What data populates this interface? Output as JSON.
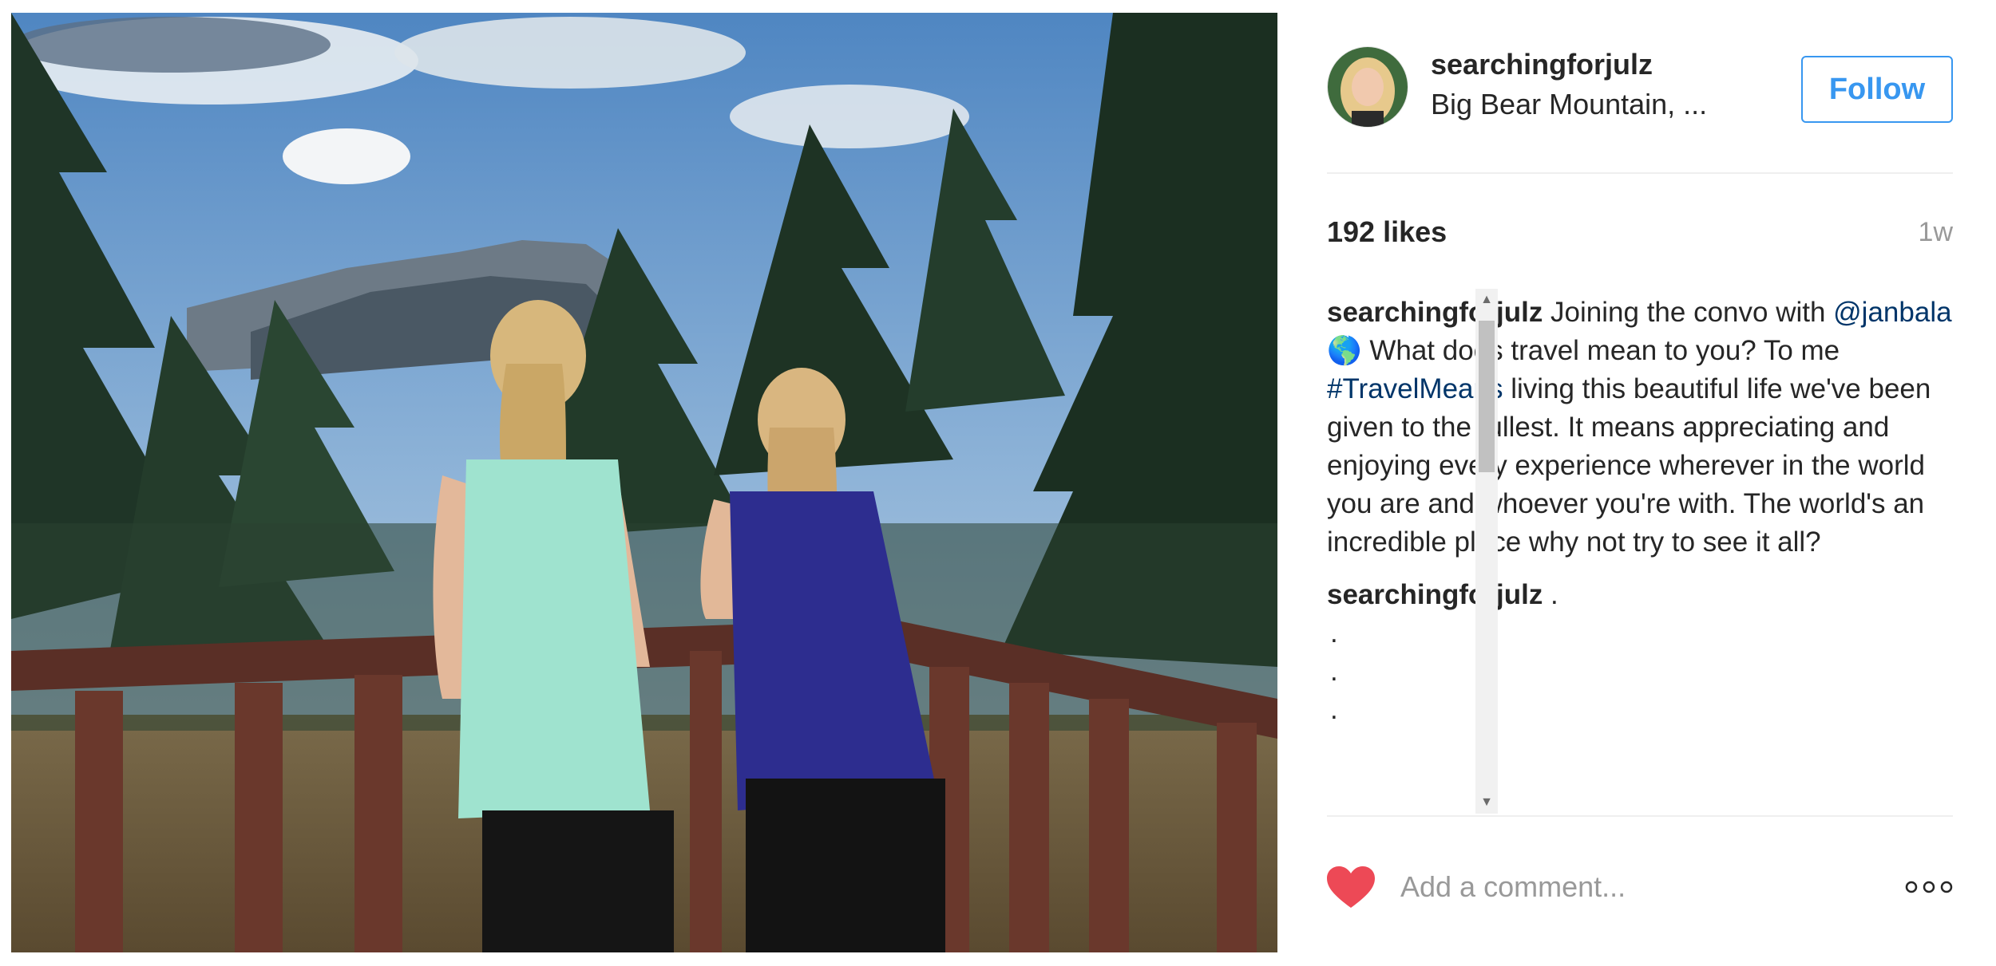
{
  "post": {
    "username": "searchingforjulz",
    "location": "Big Bear Mountain, ...",
    "follow_label": "Follow",
    "likes": "192 likes",
    "time_ago": "1w"
  },
  "caption": {
    "username": "searchingforjulz",
    "text_1": " Joining the convo with ",
    "mention": "@janbala",
    "globe": "🌎",
    "text_2": " What does travel mean to you? To me ",
    "hashtag": "#TravelMeans",
    "text_3": " living this beautiful life we've been given to the fullest. It means appreciating and enjoying every experience wherever in the world you are and whoever you're with. The world's an incredible place why not try to see it all?"
  },
  "second_comment": {
    "username": "searchingforjulz",
    "text": " .",
    "dots": [
      ".",
      ".",
      "."
    ]
  },
  "footer": {
    "comment_placeholder": "Add a comment..."
  },
  "icons": {
    "heart": "heart-icon",
    "more": "more-options-icon",
    "scroll_up": "scroll-up-arrow-icon",
    "scroll_down": "scroll-down-arrow-icon"
  },
  "colors": {
    "follow_blue": "#3897f0",
    "heart_red": "#ed4956",
    "link_blue": "#003569"
  }
}
